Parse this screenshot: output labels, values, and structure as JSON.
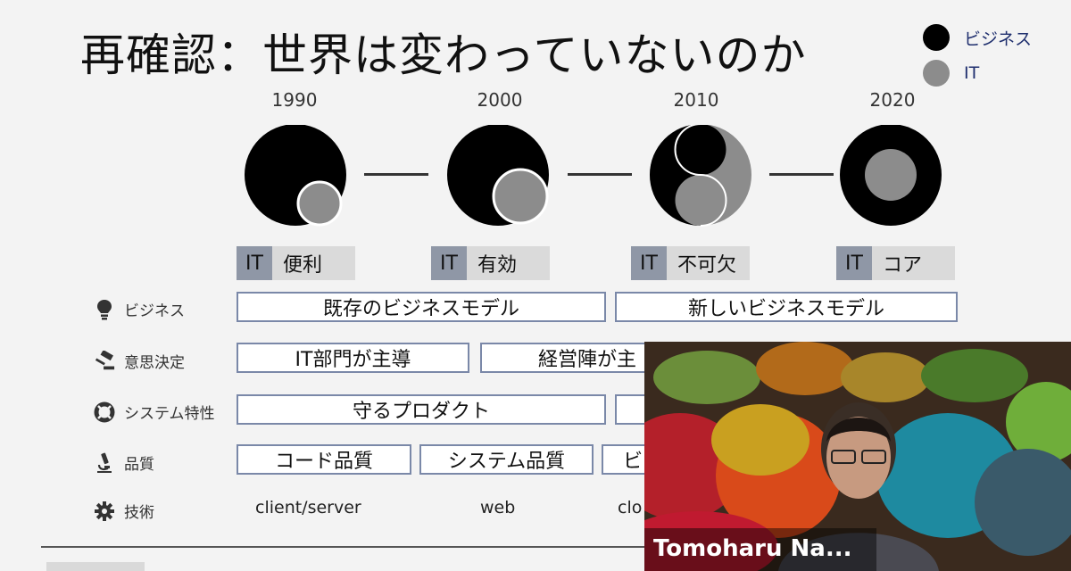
{
  "title": "再確認：世界は変わっていないのか",
  "legend": [
    {
      "label": "ビジネス",
      "color": "#000000"
    },
    {
      "label": "IT",
      "color": "#8c8c8c"
    }
  ],
  "timeline": [
    {
      "year": "1990",
      "it_tag": "IT",
      "it_label": "便利"
    },
    {
      "year": "2000",
      "it_tag": "IT",
      "it_label": "有効"
    },
    {
      "year": "2010",
      "it_tag": "IT",
      "it_label": "不可欠"
    },
    {
      "year": "2020",
      "it_tag": "IT",
      "it_label": "コア"
    }
  ],
  "rows": {
    "business": {
      "label": "ビジネス",
      "icon": "lightbulb-icon",
      "cells": [
        "既存のビジネスモデル",
        "新しいビジネスモデル"
      ]
    },
    "decision": {
      "label": "意思決定",
      "icon": "gavel-icon",
      "cells": [
        "IT部門が主導",
        "経営陣が主"
      ]
    },
    "system": {
      "label": "システム特性",
      "icon": "lifebuoy-icon",
      "cells": [
        "守るプロダクト",
        ""
      ]
    },
    "quality": {
      "label": "品質",
      "icon": "microscope-icon",
      "cells": [
        "コード品質",
        "システム品質",
        "ビ"
      ]
    },
    "tech": {
      "label": "技術",
      "icon": "gear-icon",
      "cells": [
        "client/server",
        "web",
        "clo"
      ]
    }
  },
  "video": {
    "participant_name": "Tomoharu Na..."
  }
}
